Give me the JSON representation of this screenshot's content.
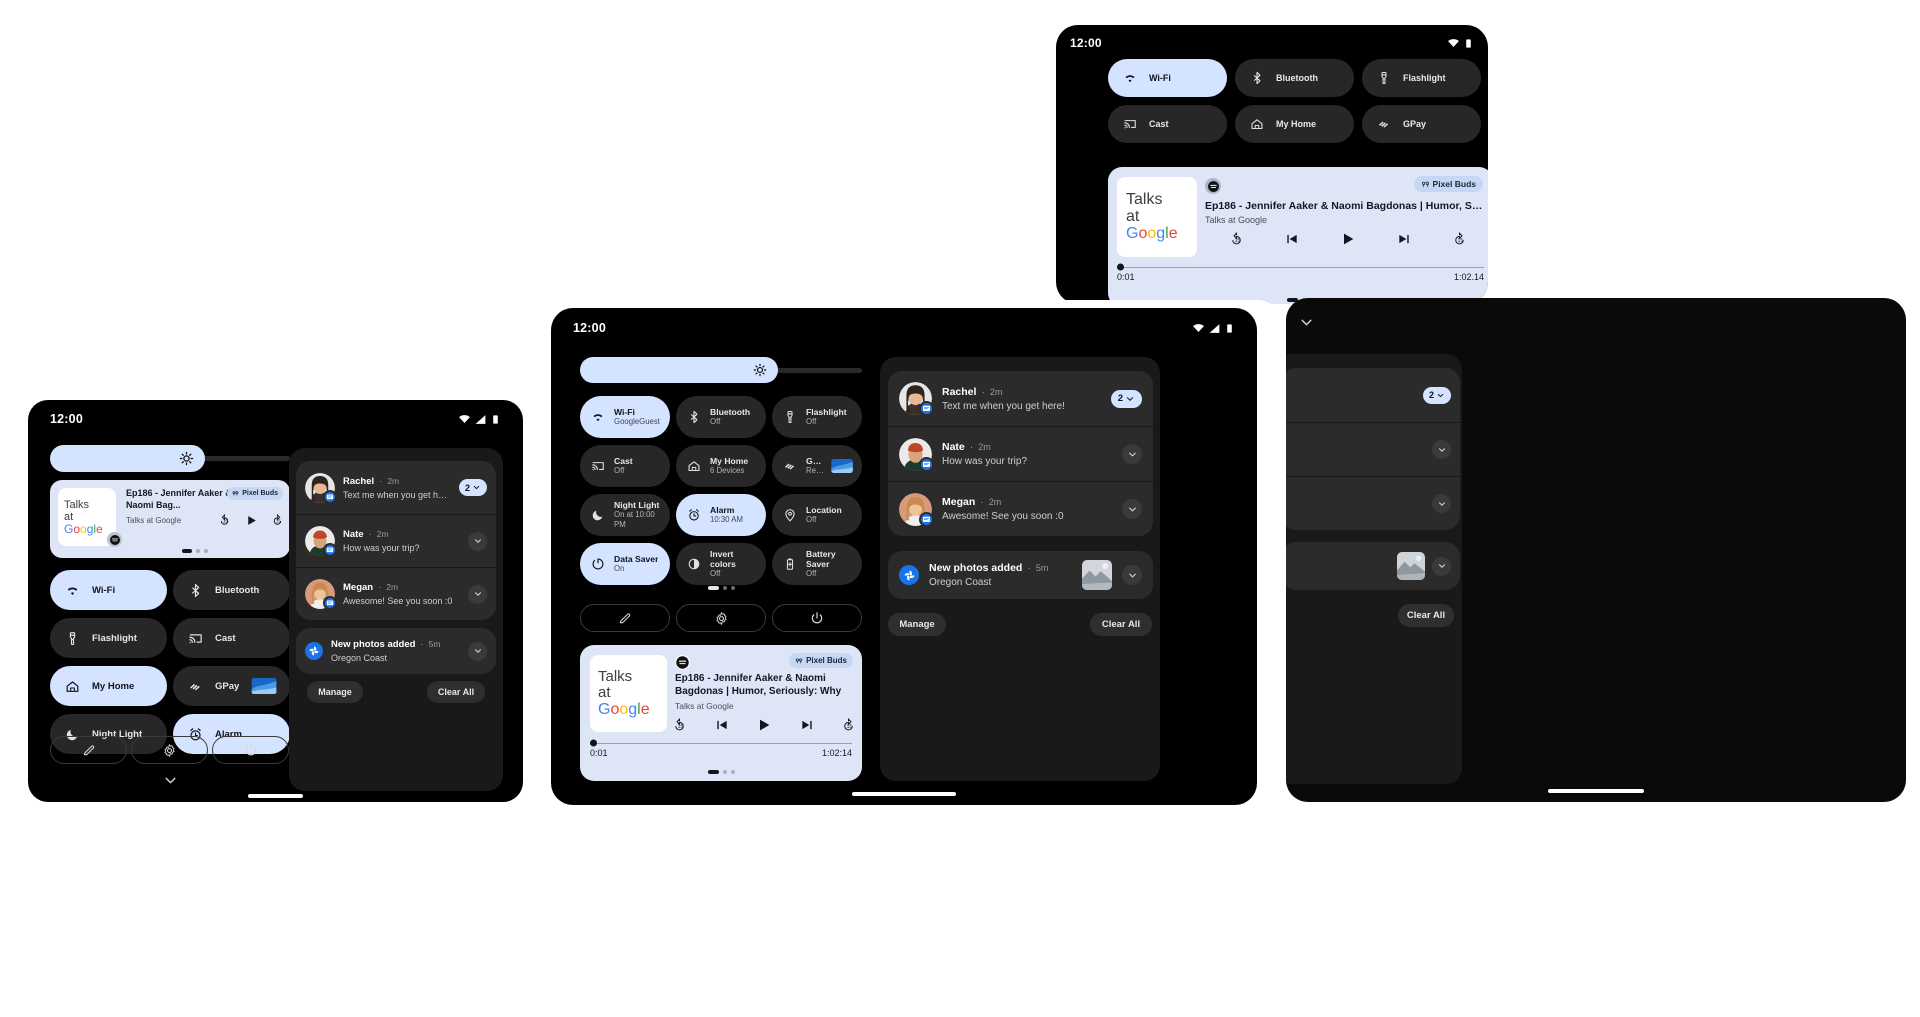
{
  "statusbar": {
    "time": "12:00",
    "icons": [
      "wifi-icon",
      "signal-icon",
      "battery-icon"
    ]
  },
  "labels": {
    "manage": "Manage",
    "clear_all": "Clear All",
    "brightness_icon": "brightness-icon",
    "edit_icon": "pencil-icon",
    "settings_icon": "gear-icon",
    "power_icon": "power-icon",
    "collapse_icon": "chevron-down-icon"
  },
  "tiles_phone": [
    {
      "label": "Wi-Fi",
      "sub": "",
      "on": true,
      "icon": "wifi-icon"
    },
    {
      "label": "Bluetooth",
      "sub": "",
      "on": false,
      "icon": "bluetooth-icon"
    },
    {
      "label": "Flashlight",
      "sub": "",
      "on": false,
      "icon": "flashlight-icon"
    },
    {
      "label": "Cast",
      "sub": "",
      "on": false,
      "icon": "cast-icon"
    },
    {
      "label": "My Home",
      "sub": "",
      "on": true,
      "icon": "home-icon"
    },
    {
      "label": "GPay",
      "sub": "",
      "on": false,
      "icon": "gpay-icon"
    },
    {
      "label": "Night Light",
      "sub": "",
      "on": false,
      "icon": "moon-icon"
    },
    {
      "label": "Alarm",
      "sub": "",
      "on": true,
      "icon": "alarm-icon"
    }
  ],
  "tiles_tablet": [
    {
      "label": "Wi-Fi",
      "sub": "GoogleGuest",
      "on": true,
      "icon": "wifi-icon"
    },
    {
      "label": "Bluetooth",
      "sub": "Off",
      "on": false,
      "icon": "bluetooth-icon"
    },
    {
      "label": "Flashlight",
      "sub": "Off",
      "on": false,
      "icon": "flashlight-icon"
    },
    {
      "label": "Cast",
      "sub": "Off",
      "on": false,
      "icon": "cast-icon"
    },
    {
      "label": "My Home",
      "sub": "6 Devices",
      "on": false,
      "icon": "home-icon"
    },
    {
      "label": "GPay",
      "sub": "Ready",
      "on": false,
      "icon": "gpay-icon"
    },
    {
      "label": "Night Light",
      "sub": "On at 10:00 PM",
      "on": false,
      "icon": "moon-icon"
    },
    {
      "label": "Alarm",
      "sub": "10:30 AM",
      "on": true,
      "icon": "alarm-icon"
    },
    {
      "label": "Location",
      "sub": "Off",
      "on": false,
      "icon": "location-icon"
    },
    {
      "label": "Data Saver",
      "sub": "On",
      "on": true,
      "icon": "datasaver-icon"
    },
    {
      "label": "Invert colors",
      "sub": "Off",
      "on": false,
      "icon": "invert-icon"
    },
    {
      "label": "Battery Saver",
      "sub": "Off",
      "on": false,
      "icon": "batterysaver-icon"
    }
  ],
  "tiles_topright": [
    {
      "label": "Wi-Fi",
      "sub": "",
      "on": true,
      "icon": "wifi-icon"
    },
    {
      "label": "Bluetooth",
      "sub": "",
      "on": false,
      "icon": "bluetooth-icon"
    },
    {
      "label": "Flashlight",
      "sub": "",
      "on": false,
      "icon": "flashlight-icon"
    },
    {
      "label": "Cast",
      "sub": "",
      "on": false,
      "icon": "cast-icon"
    },
    {
      "label": "My Home",
      "sub": "",
      "on": false,
      "icon": "home-icon"
    },
    {
      "label": "GPay",
      "sub": "",
      "on": false,
      "icon": "gpay-icon"
    }
  ],
  "media": {
    "art_line1": "Talks",
    "art_line2": "at",
    "art_google": "Google",
    "app_icon": "spotify-icon",
    "output_chip": "Pixel Buds",
    "output_icon": "earbuds-icon",
    "title_full": "Ep186 - Jennifer Aaker & Naomi Bagdonas | Humor, Seriously:...",
    "title_tablet": "Ep186 - Jennifer Aaker & Naomi Bagdonas | Humor, Seriously: Why Hum...",
    "title_phone": "Ep186 - Jennifer Aaker & Naomi Bag...",
    "subtitle": "Talks at Google",
    "elapsed": "0:01",
    "duration_tablet": "1:02:14",
    "duration_topright": "1:02.14",
    "controls": [
      "replay15-icon",
      "previous-icon",
      "play-icon",
      "next-icon",
      "forward15-icon"
    ],
    "page_dots": 3,
    "active_dot": 0
  },
  "notifications": [
    {
      "name": "Rachel",
      "time": "2m",
      "body": "Text me when you get here!",
      "avatar": "rachel-avatar",
      "expand": "2",
      "type": "message"
    },
    {
      "name": "Nate",
      "time": "2m",
      "body": "How was your trip?",
      "avatar": "nate-avatar",
      "expand": "",
      "type": "message"
    },
    {
      "name": "Megan",
      "time": "2m",
      "body": "Awesome! See you soon :0",
      "avatar": "megan-avatar",
      "expand": "",
      "type": "message"
    }
  ],
  "photo_notification": {
    "title": "New photos added",
    "time": "5m",
    "body": "Oregon Coast",
    "icon": "google-photos-icon",
    "thumb": "coast-photo-thumb"
  },
  "colors": {
    "accent_tile_on": "#d4e3ff",
    "tile_off": "#272727",
    "media_bg": "#dde5f7",
    "badge_blue": "#1a73e8",
    "device_bg": "#000000",
    "notif_bg": "#2b2b2b"
  }
}
